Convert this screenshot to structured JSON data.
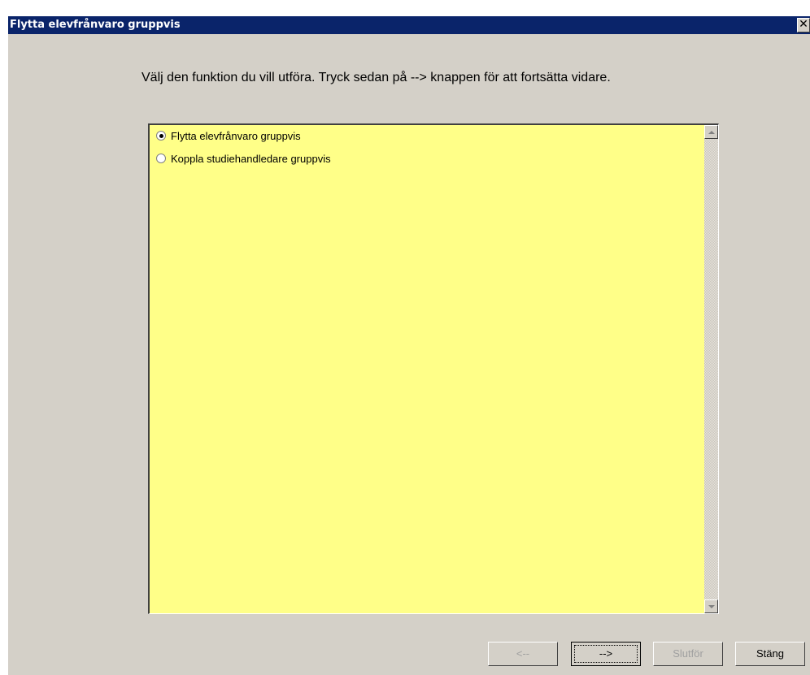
{
  "window": {
    "title": "Flytta elevfrånvaro gruppvis",
    "close_symbol": "✕"
  },
  "instructions": "Välj den funktion du vill utföra. Tryck sedan på --> knappen för att fortsätta vidare.",
  "options": [
    {
      "label": "Flytta elevfrånvaro gruppvis",
      "selected": true
    },
    {
      "label": "Koppla studiehandledare gruppvis",
      "selected": false
    }
  ],
  "buttons": {
    "back": "<--",
    "next": "-->",
    "finish": "Slutför",
    "close": "Stäng"
  },
  "colors": {
    "titlebar": "#0a246a",
    "dialog": "#d4d0c8",
    "list_background": "#ffff88"
  },
  "icons": [
    "close-icon",
    "scroll-up-arrow-icon",
    "scroll-down-arrow-icon"
  ]
}
